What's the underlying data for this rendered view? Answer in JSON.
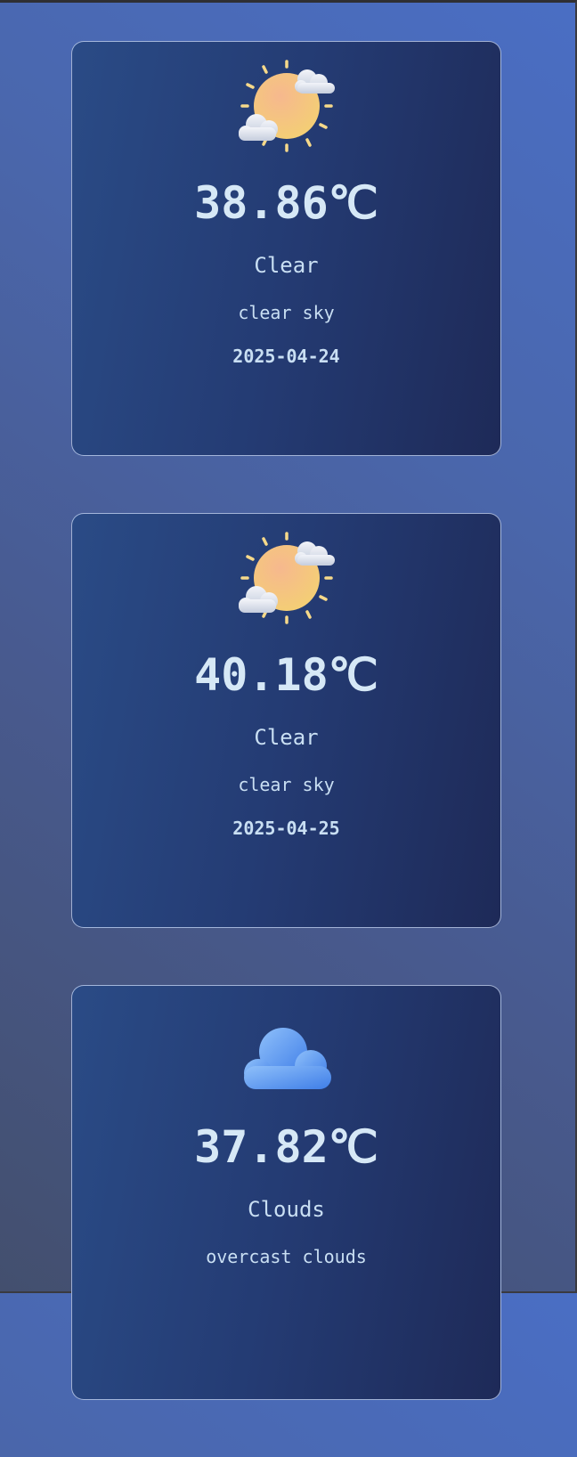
{
  "forecast": [
    {
      "icon": "sun-behind-clouds-icon",
      "temperature": "38.86℃",
      "main": "Clear",
      "description": "clear sky",
      "date": "2025-04-24"
    },
    {
      "icon": "sun-behind-clouds-icon",
      "temperature": "40.18℃",
      "main": "Clear",
      "description": "clear sky",
      "date": "2025-04-25"
    },
    {
      "icon": "cloud-icon",
      "temperature": "37.82℃",
      "main": "Clouds",
      "description": "overcast clouds",
      "date": ""
    }
  ],
  "colors": {
    "sun": "#f3c77a",
    "sun_rays": "#f6d98a",
    "cloud_light": "#dde2ee",
    "cloud_blue": "#5a98ee",
    "card_border": "#cddcf9",
    "text": "#d4e4f3"
  }
}
